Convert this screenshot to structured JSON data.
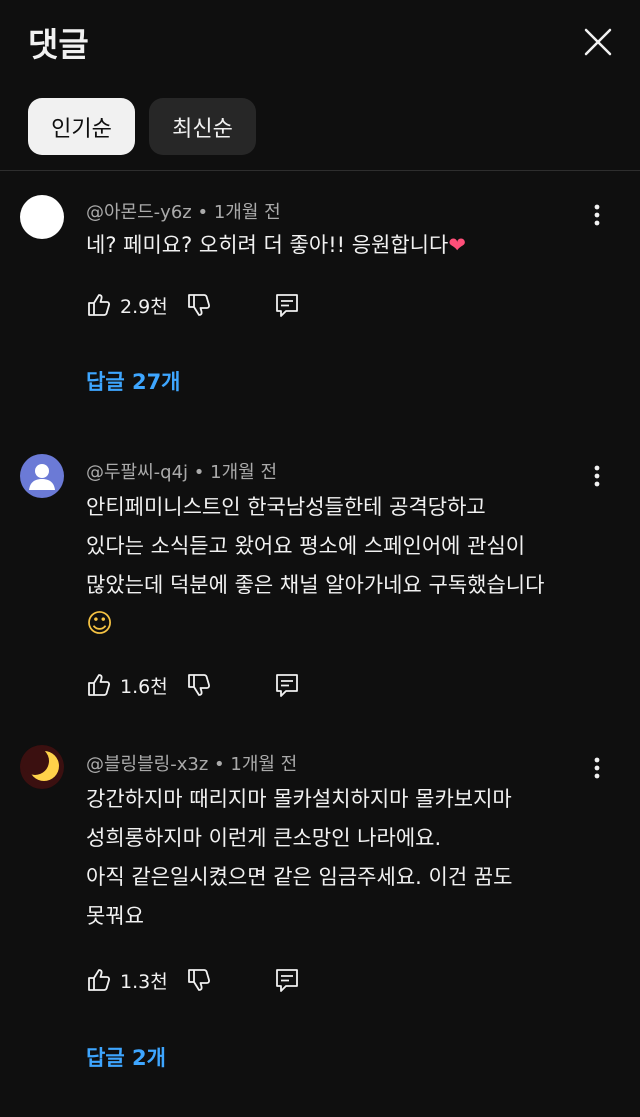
{
  "header": {
    "title": "댓글"
  },
  "sort": {
    "popular": "인기순",
    "latest": "최신순"
  },
  "comments": [
    {
      "author": "@아몬드-y6z",
      "time": "1개월 전",
      "lines": [
        "네? 페미요? 오히려 더 좋아!! 응원합니다"
      ],
      "emoji": "❤",
      "likes": "2.9천",
      "replies": "답글 27개"
    },
    {
      "author": "@두팔씨-q4j",
      "time": "1개월 전",
      "lines": [
        "안티페미니스트인 한국남성들한테 공격당하고",
        "있다는 소식듣고 왔어요 평소에 스페인어에 관심이",
        "많았는데 덕분에 좋은 채널 알아가네요 구독했습니다"
      ],
      "emoji": "☺",
      "likes": "1.6천"
    },
    {
      "author": "@블링블링-x3z",
      "time": "1개월 전",
      "lines": [
        "강간하지마 때리지마 몰카설치하지마 몰카보지마",
        "성희롱하지마 이런게 큰소망인 나라에요.",
        "아직 같은일시켰으면 같은 임금주세요. 이건 꿈도",
        "못꿔요"
      ],
      "likes": "1.3천",
      "replies": "답글 2개"
    }
  ],
  "separator": "•"
}
